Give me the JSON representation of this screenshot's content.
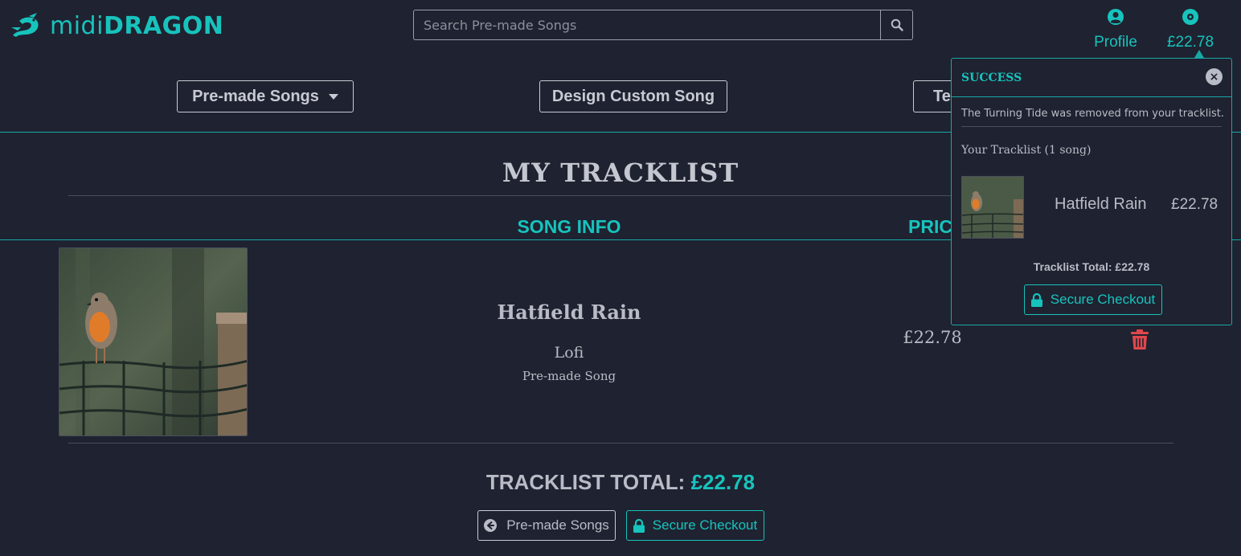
{
  "brand": {
    "name_light": "midi",
    "name_bold": "DRAGON",
    "color": "#17c3bd"
  },
  "search": {
    "placeholder": "Search Pre-made Songs",
    "value": "",
    "icon": "search-icon"
  },
  "header": {
    "profile_label": "Profile",
    "profile_icon": "user-circle-icon",
    "balance_label": "£22.78",
    "balance_icon": "disc-icon"
  },
  "nav": {
    "premade": "Pre-made Songs",
    "custom": "Design Custom Song",
    "third_partial": "Te"
  },
  "main": {
    "title": "MY TRACKLIST",
    "col_song_info": "SONG INFO",
    "col_price_partial": "PRIC",
    "item": {
      "name": "Hatfield Rain",
      "genre": "Lofi",
      "type": "Pre-made Song",
      "price": "£22.78",
      "delete_icon": "trash-icon"
    },
    "total_label": "TRACKLIST TOTAL:",
    "total_value": "£22.78",
    "back_button": "Pre-made Songs",
    "checkout_button": "Secure Checkout"
  },
  "popover": {
    "title": "SUCCESS",
    "message": "The Turning Tide was removed from your tracklist.",
    "tracklist_heading": "Your Tracklist (1 song)",
    "item_name": "Hatfield Rain",
    "item_price": "£22.78",
    "total": "Tracklist Total: £22.78",
    "checkout_button": "Secure Checkout"
  },
  "colors": {
    "accent": "#17c3bd",
    "background": "#1f2230",
    "text": "#b9bcc6",
    "danger": "#e0474c"
  }
}
